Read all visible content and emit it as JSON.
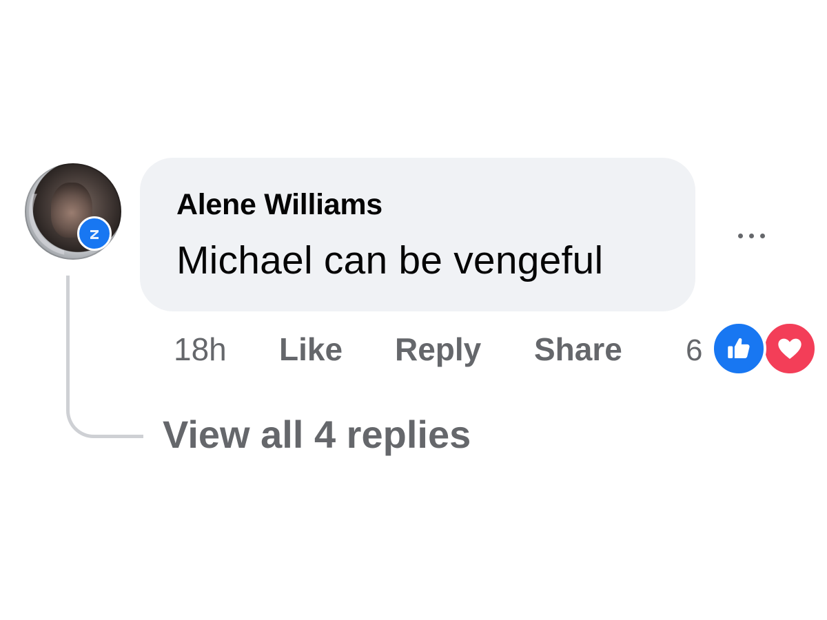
{
  "comment": {
    "author": "Alene Williams",
    "text": "Michael can be vengeful",
    "timestamp": "18h",
    "reaction_count": "6"
  },
  "actions": {
    "like_label": "Like",
    "reply_label": "Reply",
    "share_label": "Share"
  },
  "replies": {
    "view_all_label": "View all 4 replies"
  },
  "icons": {
    "more": "more-options-icon",
    "like_reaction": "thumbs-up-icon",
    "love_reaction": "heart-icon",
    "badge": "top-fan-badge-icon"
  },
  "colors": {
    "bubble_bg": "#f0f2f5",
    "secondary_text": "#65676b",
    "primary_text": "#050505",
    "like_blue": "#1877f2",
    "love_red": "#f33e58"
  }
}
